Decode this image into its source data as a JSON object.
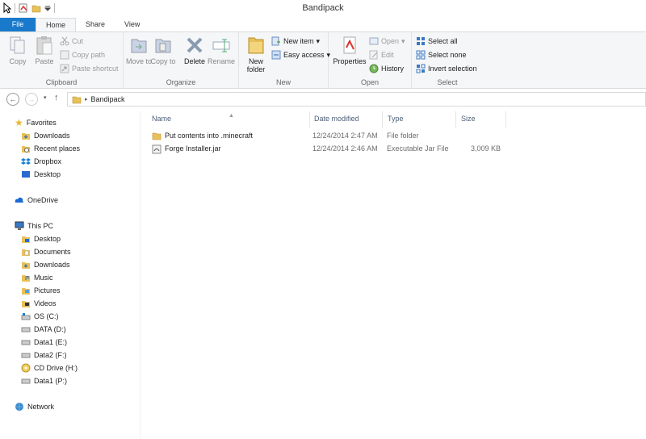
{
  "window": {
    "title": "Bandipack"
  },
  "ribbon_tabs": [
    {
      "label": "File"
    },
    {
      "label": "Home"
    },
    {
      "label": "Share"
    },
    {
      "label": "View"
    }
  ],
  "clipboard": {
    "copy": "Copy",
    "paste": "Paste",
    "cut": "Cut",
    "copy_path": "Copy path",
    "paste_shortcut": "Paste shortcut",
    "label": "Clipboard"
  },
  "organize": {
    "move_to": "Move to",
    "copy_to": "Copy to",
    "delete": "Delete",
    "rename": "Rename",
    "label": "Organize"
  },
  "new_group": {
    "new_folder": "New folder",
    "new_item": "New item",
    "easy_access": "Easy access",
    "label": "New"
  },
  "open_group": {
    "properties": "Properties",
    "open": "Open",
    "edit": "Edit",
    "history": "History",
    "label": "Open"
  },
  "select_group": {
    "select_all": "Select all",
    "select_none": "Select none",
    "invert_selection": "Invert selection",
    "label": "Select"
  },
  "address": {
    "path": "Bandipack"
  },
  "nav": {
    "favorites": "Favorites",
    "favorites_items": [
      "Downloads",
      "Recent places",
      "Dropbox",
      "Desktop"
    ],
    "onedrive": "OneDrive",
    "this_pc": "This PC",
    "pc_items": [
      "Desktop",
      "Documents",
      "Downloads",
      "Music",
      "Pictures",
      "Videos",
      "OS (C:)",
      "DATA (D:)",
      "Data1 (E:)",
      "Data2 (F:)",
      "CD Drive (H:)",
      "Data1 (P:)"
    ],
    "network": "Network"
  },
  "columns": {
    "name": "Name",
    "date": "Date modified",
    "type": "Type",
    "size": "Size"
  },
  "files": [
    {
      "name": "Put contents into .minecraft",
      "date": "12/24/2014 2:47 AM",
      "type": "File folder",
      "size": ""
    },
    {
      "name": "Forge Installer.jar",
      "date": "12/24/2014 2:46 AM",
      "type": "Executable Jar File",
      "size": "3,009 KB"
    }
  ],
  "colors": {
    "accent": "#1979ca",
    "folder": "#e8c15a",
    "header_text": "#4c607a"
  }
}
